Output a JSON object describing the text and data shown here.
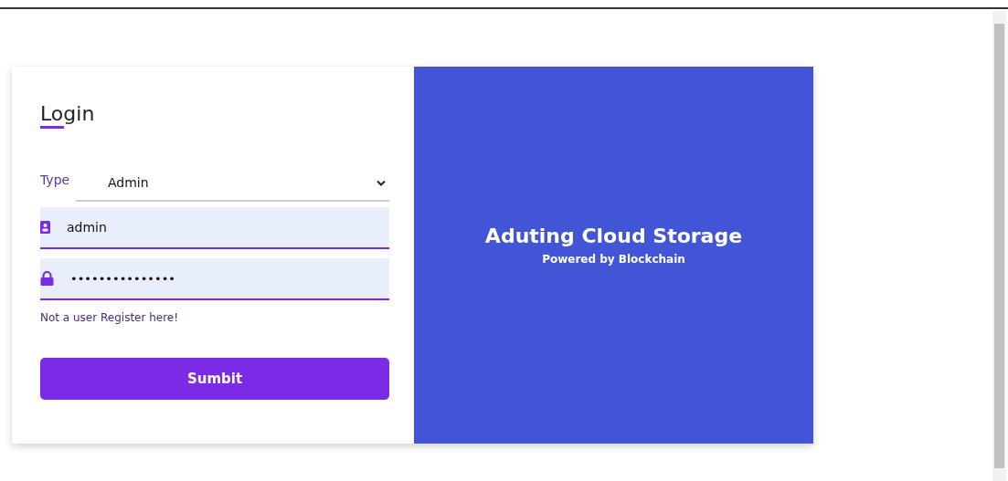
{
  "login": {
    "title": "Login",
    "type_field": {
      "label": "Type",
      "value": "Admin"
    },
    "username": {
      "value": "admin"
    },
    "password": {
      "value": "•••••••••••••••"
    },
    "register_link": "Not a user Register here!",
    "submit_button": "Sumbit"
  },
  "banner": {
    "title": "Aduting Cloud Storage",
    "subtitle": "Powered by Blockchain"
  }
}
